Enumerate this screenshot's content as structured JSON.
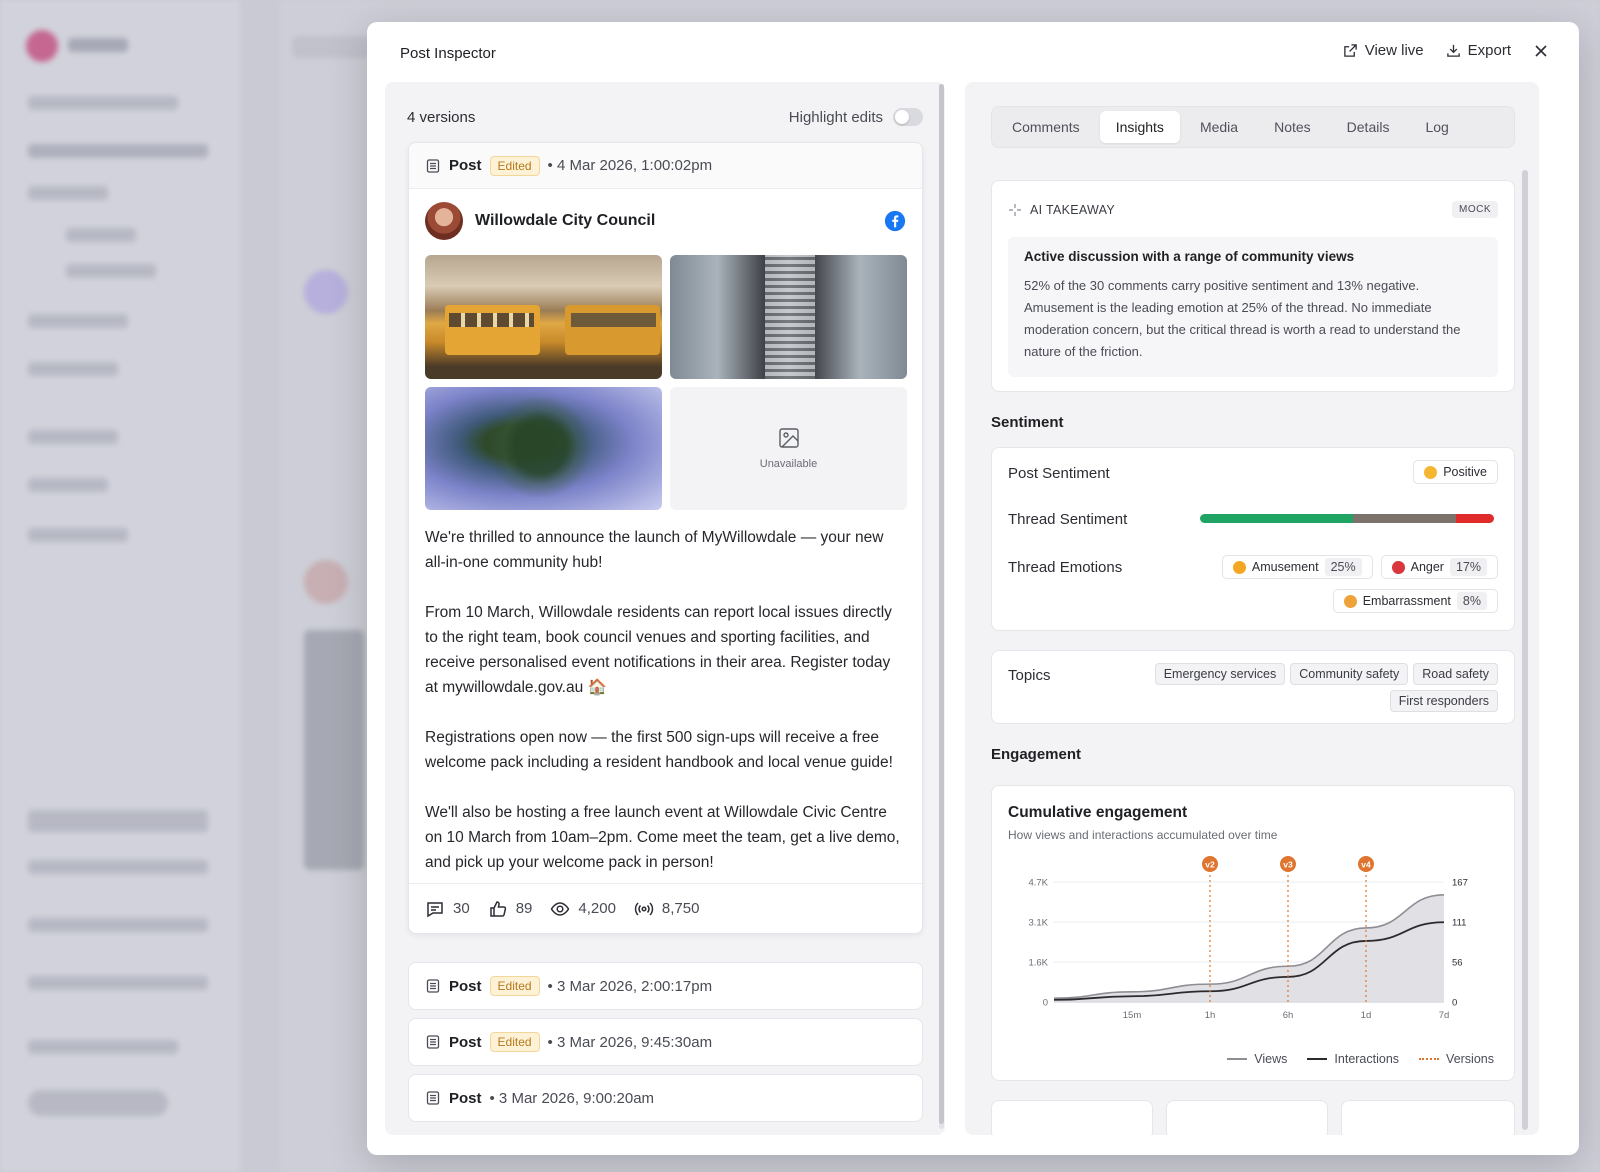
{
  "modal": {
    "title": "Post Inspector",
    "view_live": "View live",
    "export": "Export"
  },
  "versions": {
    "count_label": "4 versions",
    "highlight_label": "Highlight edits",
    "list": [
      {
        "type": "Post",
        "badge": "Edited",
        "date": "• 4 Mar 2026, 1:00:02pm"
      },
      {
        "type": "Post",
        "badge": "Edited",
        "date": "• 3 Mar 2026, 2:00:17pm"
      },
      {
        "type": "Post",
        "badge": "Edited",
        "date": "• 3 Mar 2026, 9:45:30am"
      },
      {
        "type": "Post",
        "badge": "",
        "date": "• 3 Mar 2026, 9:00:20am"
      }
    ]
  },
  "post": {
    "author": "Willowdale City Council",
    "unavailable_label": "Unavailable",
    "paragraphs": [
      "We're thrilled to announce the launch of MyWillowdale — your new all-in-one community hub!",
      "From 10 March, Willowdale residents can report local issues directly to the right team, book council venues and sporting facilities, and receive personalised event notifications in their area. Register today at mywillowdale.gov.au 🏠",
      "Registrations open now — the first 500 sign-ups will receive a free welcome pack including a resident handbook and local venue guide!",
      "We'll also be hosting a free launch event at Willowdale Civic Centre on 10 March from 10am–2pm. Come meet the team, get a live demo, and pick up your welcome pack in person!"
    ],
    "stats": {
      "comments": "30",
      "likes": "89",
      "views": "4,200",
      "reach": "8,750"
    }
  },
  "tabs": [
    "Comments",
    "Insights",
    "Media",
    "Notes",
    "Details",
    "Log"
  ],
  "active_tab": "Insights",
  "ai": {
    "label": "AI TAKEAWAY",
    "badge": "MOCK",
    "headline": "Active discussion with a range of community views",
    "body": "52% of the 30 comments carry positive sentiment and 13% negative. Amusement is the leading emotion at 25% of the thread. No immediate moderation concern, but the critical thread is worth a read to understand the nature of the friction."
  },
  "sentiment": {
    "title": "Sentiment",
    "post_label": "Post Sentiment",
    "post_value": "Positive",
    "thread_label": "Thread Sentiment",
    "thread_bar": {
      "positive": 52,
      "neutral": 35,
      "negative": 13
    },
    "emotions_label": "Thread Emotions",
    "emotions": [
      {
        "name": "Amusement",
        "pct": "25%"
      },
      {
        "name": "Anger",
        "pct": "17%"
      },
      {
        "name": "Embarrassment",
        "pct": "8%"
      }
    ],
    "colors": {
      "positive": "#1fa463",
      "neutral": "#7b726c",
      "negative": "#e02b2b"
    }
  },
  "topics": {
    "label": "Topics",
    "items": [
      "Emergency services",
      "Community safety",
      "Road safety",
      "First responders"
    ]
  },
  "engagement": {
    "title": "Engagement",
    "chart_title": "Cumulative engagement",
    "chart_subtitle": "How views and interactions accumulated over time",
    "legend": {
      "views": "Views",
      "interactions": "Interactions",
      "versions": "Versions"
    }
  },
  "chart_data": {
    "type": "area",
    "x": [
      "0",
      "15m",
      "1h",
      "6h",
      "1d",
      "7d"
    ],
    "x_ticks": [
      "15m",
      "1h",
      "6h",
      "1d",
      "7d"
    ],
    "y_left_ticks": [
      "0",
      "1.6K",
      "3.1K",
      "4.7K"
    ],
    "y_right_ticks": [
      "0",
      "56",
      "111",
      "167"
    ],
    "ylim_left": [
      0,
      4700
    ],
    "ylim_right": [
      0,
      167
    ],
    "series": [
      {
        "name": "Views",
        "axis": "left",
        "values": [
          150,
          400,
          700,
          1400,
          2900,
          4200
        ]
      },
      {
        "name": "Interactions",
        "axis": "right",
        "values": [
          3,
          8,
          15,
          35,
          85,
          111
        ]
      }
    ],
    "version_markers": [
      {
        "label": "v2",
        "x": "1h"
      },
      {
        "label": "v3",
        "x": "6h"
      },
      {
        "label": "v4",
        "x": "1d"
      }
    ]
  }
}
